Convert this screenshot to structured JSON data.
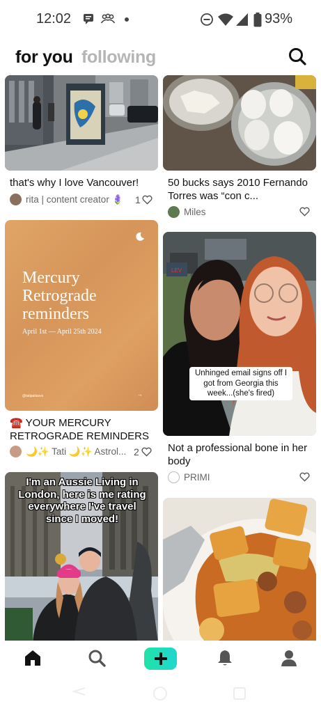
{
  "status_bar": {
    "time": "12:02",
    "battery": "93%"
  },
  "header": {
    "tab_for_you": "for you",
    "tab_following": "following"
  },
  "feed": {
    "left": [
      {
        "title": "that's why I love Vancouver!",
        "author": "rita | content creator 🪻",
        "likes": "1"
      },
      {
        "cover_title": "Mercury Retrograde reminders",
        "cover_dates": "April 1st — April 25th 2024",
        "cover_handle": "@tatipatlaxvs",
        "title": "☎️ YOUR MERCURY RETROGRADE REMINDERS ...",
        "author": "🌙✨ Tati 🌙✨ Astrol...",
        "likes": "2"
      },
      {
        "overlay": "I'm an Aussie Living in London, here is me rating everywhere I've travel since I moved!"
      }
    ],
    "right": [
      {
        "title": "50 bucks says 2010 Fernando Torres was “con c...",
        "author": "Miles"
      },
      {
        "caption": "Unhinged email signs off I got from Georgia this week...(she's fired)",
        "title": "Not a professional bone in her body",
        "author": "PRIMI"
      },
      {}
    ]
  },
  "colors": {
    "accent": "#20dcb8",
    "muted_tab": "#b5b5b5",
    "mercury_bg": "#dc9b5e"
  },
  "icons": [
    "home-icon",
    "search-icon",
    "plus-icon",
    "bell-icon",
    "profile-icon",
    "heart-icon"
  ]
}
